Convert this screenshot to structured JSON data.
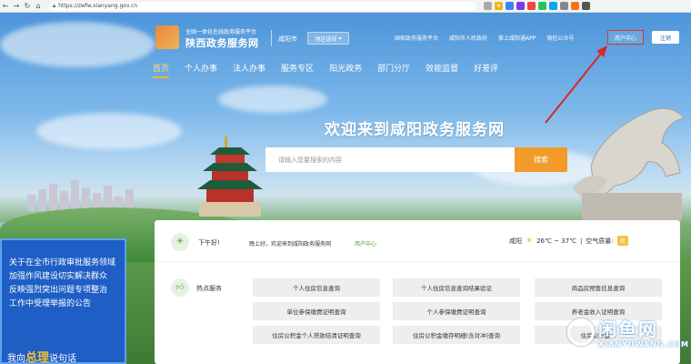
{
  "browser": {
    "url": "https://zwfw.xianyang.gov.cn",
    "nav_icons": [
      "←",
      "→",
      "↻",
      "⌂"
    ]
  },
  "header": {
    "platform_line": "全国一体化在线政务服务平台",
    "site_name": "陕西政务服务网",
    "city": "咸阳市",
    "region_select": "地区选择",
    "top_links": [
      "国家政务服务平台",
      "咸阳市人民政府",
      "掌上咸阳通APP",
      "微信公众号"
    ],
    "user_center": "用户中心",
    "login": "注销"
  },
  "mainnav": [
    "首页",
    "个人办事",
    "法人办事",
    "服务专区",
    "阳光政务",
    "部门分厅",
    "效能监督",
    "好差评"
  ],
  "hero": {
    "title": "欢迎来到咸阳政务服务网",
    "search_placeholder": "请输入您要搜索的内容",
    "search_button": "搜索"
  },
  "info": {
    "greeting": "下午好!",
    "welcome": "晚上好，欢迎来到咸阳政务服务网",
    "user_center_link": "用户中心",
    "weather_city": "咸阳",
    "temperature": "26℃ ~ 37℃",
    "air_quality_label": "空气质量:",
    "air_quality_value": "良"
  },
  "hot_services": {
    "label": "热点服务",
    "items": [
      "个人住房信息查询",
      "个人住房信息查询结果验证",
      "商品房预售信息查询",
      "单位参保缴费证明查询",
      "个人参保缴费证明查询",
      "养老金收入证明查询",
      "住房公积金个人贷款结清证明查询",
      "住房公积金缴存明细(含对冲)查询",
      "住房公积金..."
    ]
  },
  "banner": {
    "lines": [
      "关于在全市行政审批服务领域",
      "加强作风建设切实解决群众",
      "反映强烈突出问题专项整治",
      "工作中受理举报的公告"
    ],
    "foot_pre": "我向",
    "foot_highlight": "总理",
    "foot_post": "说句话"
  },
  "watermark": {
    "main": "闲鱼网",
    "sub": "XIANYUWANG.COM"
  },
  "colors": {
    "accent": "#f39b2a",
    "highlight_box": "#d33333",
    "arrow": "#d62828",
    "green": "#57a33c"
  }
}
